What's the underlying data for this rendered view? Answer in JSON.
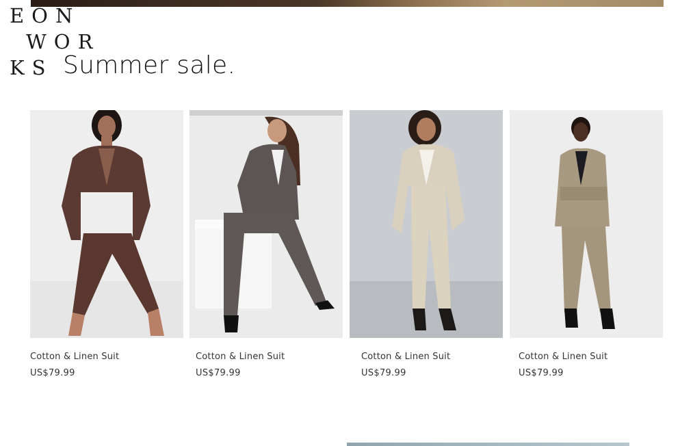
{
  "brand": {
    "logo_line1": "EON",
    "logo_line2": "WOR",
    "logo_line3": "KS"
  },
  "section": {
    "title": "Summer sale."
  },
  "products": [
    {
      "name": "Cotton & Linen Suit",
      "price": "US$79.99",
      "icon": "brown-suit-photo"
    },
    {
      "name": "Cotton & Linen Suit",
      "price": "US$79.99",
      "icon": "grey-suit-photo"
    },
    {
      "name": "Cotton & Linen Suit",
      "price": "US$79.99",
      "icon": "beige-suit-photo"
    },
    {
      "name": "Cotton & Linen Suit",
      "price": "US$79.99",
      "icon": "checked-suit-photo"
    }
  ],
  "colors": {
    "text": "#111111",
    "price_text": "#333333",
    "background": "#ffffff"
  }
}
